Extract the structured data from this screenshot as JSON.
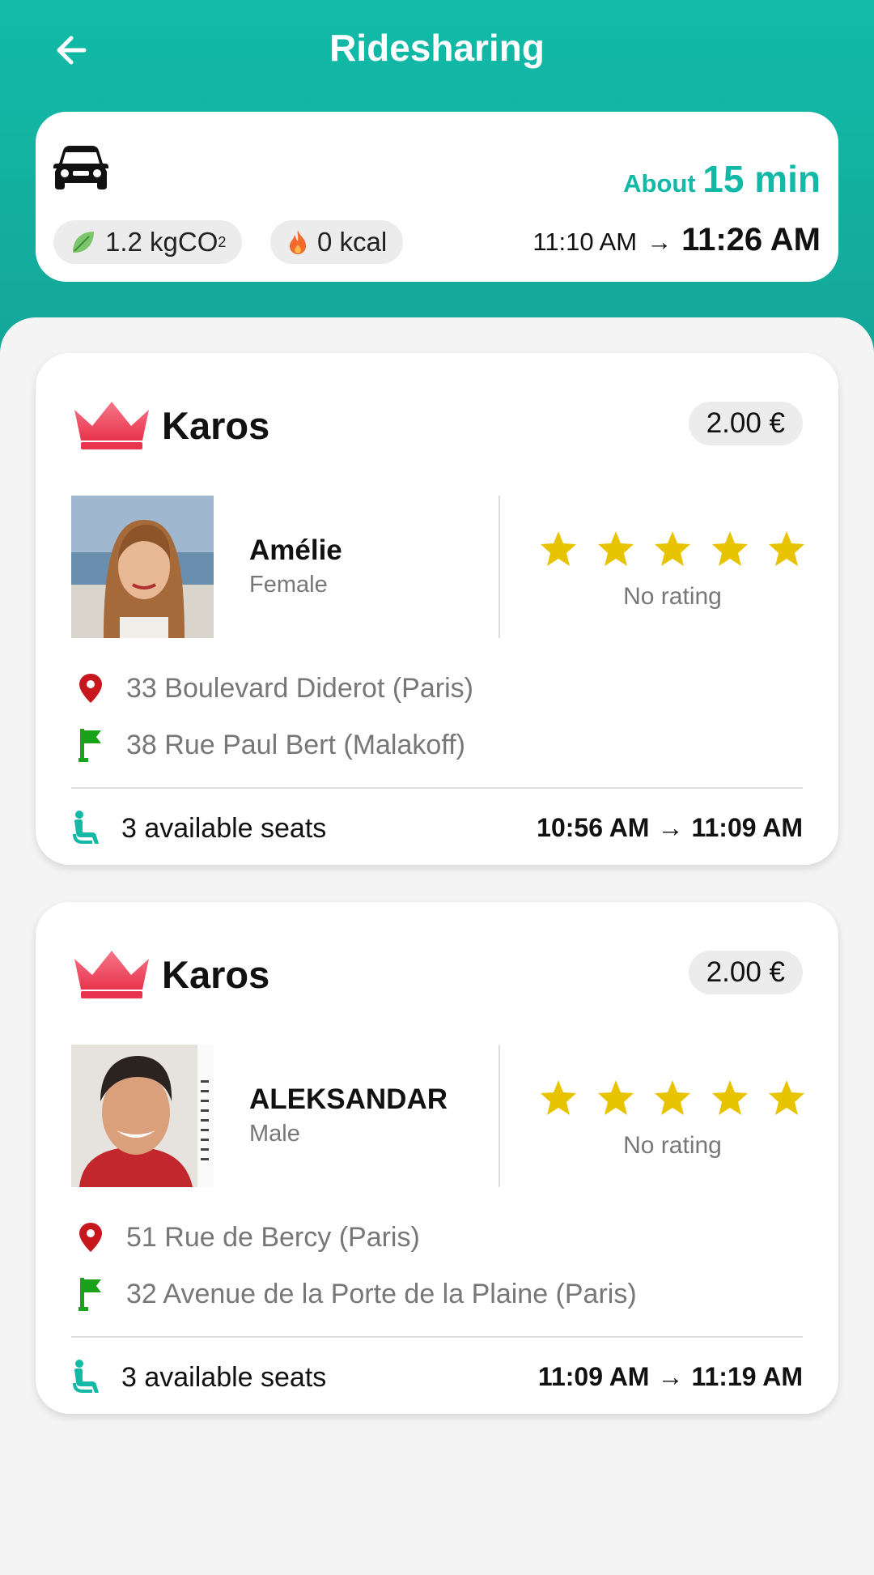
{
  "header": {
    "title": "Ridesharing"
  },
  "summary": {
    "co2": "1.2 kgCO",
    "co2_sub": "2",
    "kcal": "0 kcal",
    "about_prefix": "About",
    "about_value": "15 min",
    "departure": "11:10 AM",
    "arrow": "→",
    "arrival": "11:26 AM"
  },
  "rides": [
    {
      "provider": "Karos",
      "price": "2.00 €",
      "driver_name": "Amélie",
      "driver_gender": "Female",
      "rating_text": "No rating",
      "from": "33 Boulevard Diderot (Paris)",
      "to": "38 Rue Paul Bert (Malakoff)",
      "seats": "3 available seats",
      "depart": "10:56 AM",
      "arrow": "→",
      "arrive": "11:09 AM"
    },
    {
      "provider": "Karos",
      "price": "2.00 €",
      "driver_name": "ALEKSANDAR",
      "driver_gender": "Male",
      "rating_text": "No rating",
      "from": "51 Rue de Bercy (Paris)",
      "to": "32 Avenue de la Porte de la Plaine (Paris)",
      "seats": "3 available seats",
      "depart": "11:09 AM",
      "arrow": "→",
      "arrive": "11:19 AM"
    }
  ],
  "icons": {
    "back": "arrow-left-icon",
    "car": "car-icon",
    "leaf": "leaf-icon",
    "flame": "flame-icon",
    "crown": "crown-icon",
    "star": "star-icon",
    "pin": "location-pin-icon",
    "flag": "flag-icon",
    "seat": "seat-icon"
  },
  "colors": {
    "accent": "#14b8a6",
    "star": "#e8c400",
    "pin": "#c8161d",
    "flag": "#1aa31a",
    "crown": "#ef4a5e"
  }
}
